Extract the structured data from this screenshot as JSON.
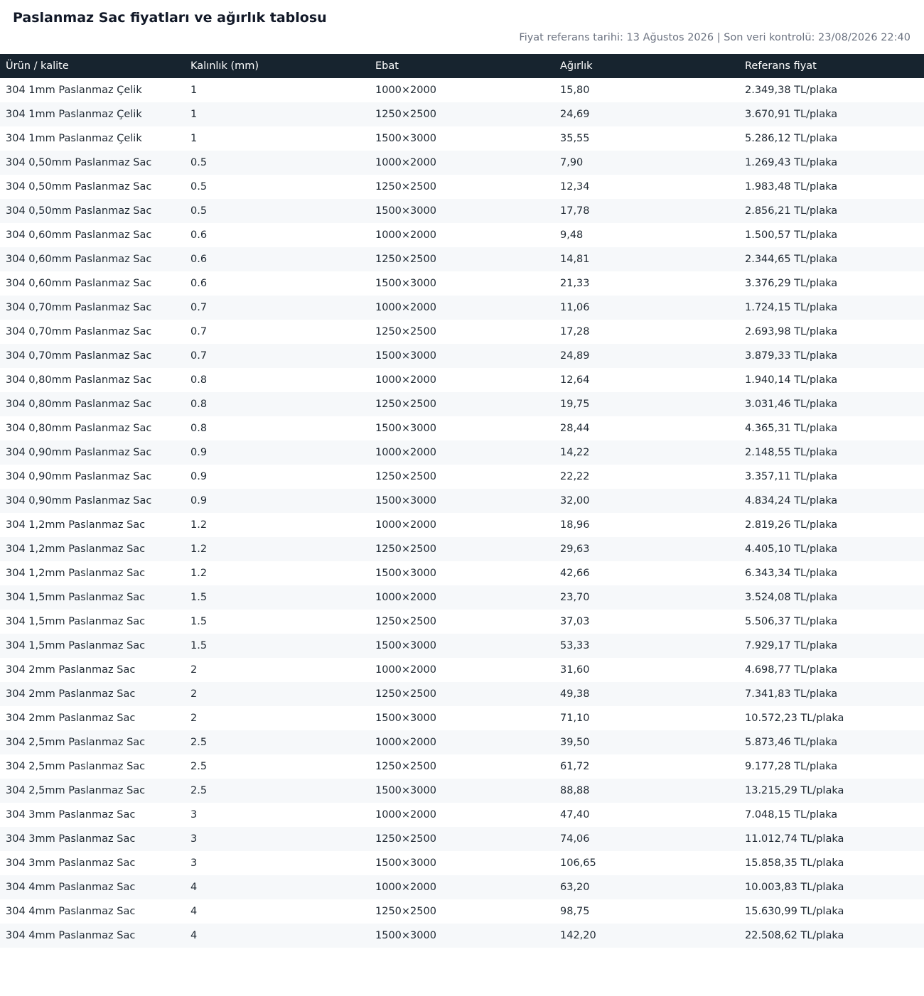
{
  "page": {
    "title": "Paslanmaz Sac fiyatları ve ağırlık tablosu",
    "meta": "Fiyat referans tarihi: 13 Ağustos 2026 | Son veri kontrolü: 23/08/2026 22:40"
  },
  "table": {
    "headers": [
      "Ürün / kalite",
      "Kalınlık (mm)",
      "Ebat",
      "Ağırlık",
      "Referans fiyat"
    ],
    "rows": [
      [
        "304 1mm Paslanmaz Çelik",
        "1",
        "1000×2000",
        "15,80",
        "2.349,38 TL/plaka"
      ],
      [
        "304 1mm Paslanmaz Çelik",
        "1",
        "1250×2500",
        "24,69",
        "3.670,91 TL/plaka"
      ],
      [
        "304 1mm Paslanmaz Çelik",
        "1",
        "1500×3000",
        "35,55",
        "5.286,12 TL/plaka"
      ],
      [
        "304 0,50mm Paslanmaz Sac",
        "0.5",
        "1000×2000",
        "7,90",
        "1.269,43 TL/plaka"
      ],
      [
        "304 0,50mm Paslanmaz Sac",
        "0.5",
        "1250×2500",
        "12,34",
        "1.983,48 TL/plaka"
      ],
      [
        "304 0,50mm Paslanmaz Sac",
        "0.5",
        "1500×3000",
        "17,78",
        "2.856,21 TL/plaka"
      ],
      [
        "304 0,60mm Paslanmaz Sac",
        "0.6",
        "1000×2000",
        "9,48",
        "1.500,57 TL/plaka"
      ],
      [
        "304 0,60mm Paslanmaz Sac",
        "0.6",
        "1250×2500",
        "14,81",
        "2.344,65 TL/plaka"
      ],
      [
        "304 0,60mm Paslanmaz Sac",
        "0.6",
        "1500×3000",
        "21,33",
        "3.376,29 TL/plaka"
      ],
      [
        "304 0,70mm Paslanmaz Sac",
        "0.7",
        "1000×2000",
        "11,06",
        "1.724,15 TL/plaka"
      ],
      [
        "304 0,70mm Paslanmaz Sac",
        "0.7",
        "1250×2500",
        "17,28",
        "2.693,98 TL/plaka"
      ],
      [
        "304 0,70mm Paslanmaz Sac",
        "0.7",
        "1500×3000",
        "24,89",
        "3.879,33 TL/plaka"
      ],
      [
        "304 0,80mm Paslanmaz Sac",
        "0.8",
        "1000×2000",
        "12,64",
        "1.940,14 TL/plaka"
      ],
      [
        "304 0,80mm Paslanmaz Sac",
        "0.8",
        "1250×2500",
        "19,75",
        "3.031,46 TL/plaka"
      ],
      [
        "304 0,80mm Paslanmaz Sac",
        "0.8",
        "1500×3000",
        "28,44",
        "4.365,31 TL/plaka"
      ],
      [
        "304 0,90mm Paslanmaz Sac",
        "0.9",
        "1000×2000",
        "14,22",
        "2.148,55 TL/plaka"
      ],
      [
        "304 0,90mm Paslanmaz Sac",
        "0.9",
        "1250×2500",
        "22,22",
        "3.357,11 TL/plaka"
      ],
      [
        "304 0,90mm Paslanmaz Sac",
        "0.9",
        "1500×3000",
        "32,00",
        "4.834,24 TL/plaka"
      ],
      [
        "304 1,2mm Paslanmaz Sac",
        "1.2",
        "1000×2000",
        "18,96",
        "2.819,26 TL/plaka"
      ],
      [
        "304 1,2mm Paslanmaz Sac",
        "1.2",
        "1250×2500",
        "29,63",
        "4.405,10 TL/plaka"
      ],
      [
        "304 1,2mm Paslanmaz Sac",
        "1.2",
        "1500×3000",
        "42,66",
        "6.343,34 TL/plaka"
      ],
      [
        "304 1,5mm Paslanmaz Sac",
        "1.5",
        "1000×2000",
        "23,70",
        "3.524,08 TL/plaka"
      ],
      [
        "304 1,5mm Paslanmaz Sac",
        "1.5",
        "1250×2500",
        "37,03",
        "5.506,37 TL/plaka"
      ],
      [
        "304 1,5mm Paslanmaz Sac",
        "1.5",
        "1500×3000",
        "53,33",
        "7.929,17 TL/plaka"
      ],
      [
        "304 2mm Paslanmaz Sac",
        "2",
        "1000×2000",
        "31,60",
        "4.698,77 TL/plaka"
      ],
      [
        "304 2mm Paslanmaz Sac",
        "2",
        "1250×2500",
        "49,38",
        "7.341,83 TL/plaka"
      ],
      [
        "304 2mm Paslanmaz Sac",
        "2",
        "1500×3000",
        "71,10",
        "10.572,23 TL/plaka"
      ],
      [
        "304 2,5mm Paslanmaz Sac",
        "2.5",
        "1000×2000",
        "39,50",
        "5.873,46 TL/plaka"
      ],
      [
        "304 2,5mm Paslanmaz Sac",
        "2.5",
        "1250×2500",
        "61,72",
        "9.177,28 TL/plaka"
      ],
      [
        "304 2,5mm Paslanmaz Sac",
        "2.5",
        "1500×3000",
        "88,88",
        "13.215,29 TL/plaka"
      ],
      [
        "304 3mm Paslanmaz Sac",
        "3",
        "1000×2000",
        "47,40",
        "7.048,15 TL/plaka"
      ],
      [
        "304 3mm Paslanmaz Sac",
        "3",
        "1250×2500",
        "74,06",
        "11.012,74 TL/plaka"
      ],
      [
        "304 3mm Paslanmaz Sac",
        "3",
        "1500×3000",
        "106,65",
        "15.858,35 TL/plaka"
      ],
      [
        "304 4mm Paslanmaz Sac",
        "4",
        "1000×2000",
        "63,20",
        "10.003,83 TL/plaka"
      ],
      [
        "304 4mm Paslanmaz Sac",
        "4",
        "1250×2500",
        "98,75",
        "15.630,99 TL/plaka"
      ],
      [
        "304 4mm Paslanmaz Sac",
        "4",
        "1500×3000",
        "142,20",
        "22.508,62 TL/plaka"
      ]
    ]
  },
  "colors": {
    "header_bg": "#17242f",
    "header_text": "#ffffff",
    "row_alt_bg": "#f6f8fa",
    "meta_text": "#6b7280"
  }
}
